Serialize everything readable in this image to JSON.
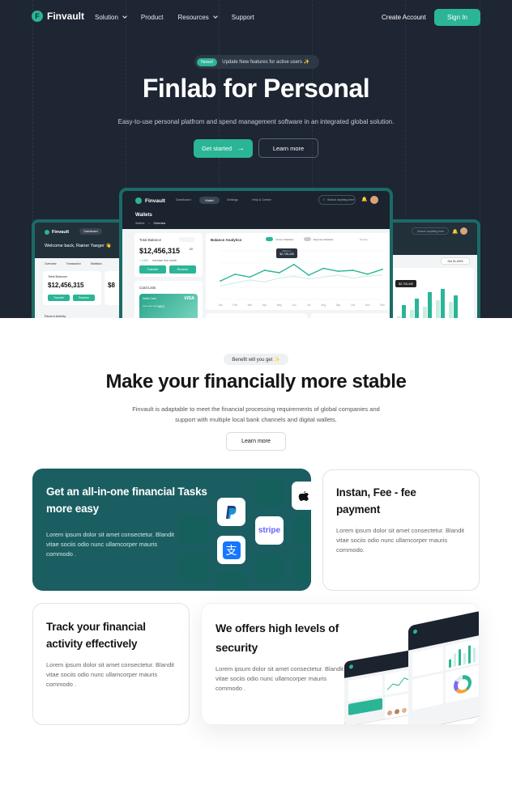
{
  "nav": {
    "brand": "Finvault",
    "brand_mark": "F",
    "links": [
      {
        "label": "Solution",
        "dropdown": true
      },
      {
        "label": "Product",
        "dropdown": false
      },
      {
        "label": "Resources",
        "dropdown": true
      },
      {
        "label": "Support",
        "dropdown": false
      }
    ],
    "create_account": "Create Account",
    "sign_in": "Sign In"
  },
  "hero": {
    "badge": "News!",
    "announcement": "Update New features for active users ✨",
    "title": "Finlab for Personal",
    "subtitle": "Easy-to-use personal platfrom and spend management software in an integrated global solution.",
    "primary_cta": "Get started",
    "secondary_cta": "Learn more"
  },
  "dashboard": {
    "brand": "Finvault",
    "tabs": [
      "Dashboard",
      "Wallet",
      "Settings",
      "Help & Center"
    ],
    "search_placeholder": "Search anything here",
    "page_title": "Wallets",
    "breadcrumb": [
      "Wallets",
      "Overview"
    ],
    "total_balance_label": "Total Balance",
    "total_balance": "$12,456,315",
    "balance_cents": ".00",
    "balance_growth": "+ 4.5%",
    "balance_note": "increase this month",
    "transfer": "Transfer",
    "receive": "Receive",
    "card_lists": "Card Lists",
    "card_network": "VISA",
    "card_label": "Debit Card",
    "card_number": "**** **** **** 8824",
    "analytics_title": "Balance Analytics",
    "toggle_1": "Income Statistics",
    "toggle_2": "Expense Statistics",
    "range": "Monthly",
    "tooltip_label": "Balance",
    "tooltip_value": "$2,745,445",
    "welcome": "Welcome back, Rainer Yaeger 👋",
    "left_tabs": [
      "Overview",
      "Transaction",
      "Statistics"
    ],
    "left_balance": "$12,456,315",
    "recent": "Recent Activity",
    "right_date": "Oct 31,2023",
    "right_tooltip": "$2,745,445",
    "right_value": "$8"
  },
  "chart_data": {
    "type": "line",
    "x": [
      "Jan",
      "Feb",
      "Mar",
      "Apr",
      "May",
      "Jun",
      "Jul",
      "Aug",
      "Sep",
      "Oct",
      "Nov",
      "Dec"
    ],
    "series": [
      {
        "values": [
          38,
          52,
          46,
          60,
          55,
          72,
          50,
          64,
          58,
          60,
          52,
          62
        ],
        "color": "#2bb596"
      },
      {
        "values": [
          28,
          34,
          40,
          36,
          44,
          48,
          42,
          46,
          50,
          44,
          48,
          50
        ],
        "color": "#c9ece2"
      }
    ],
    "ylim": [
      0,
      100
    ]
  },
  "section": {
    "badge": "Benefit will you get ✨",
    "title": "Make your financially more stable",
    "description": "Finvault is adaptable to meet the financial processing requirements of global companies and support with multiple local bank channels and digital wallets.",
    "cta": "Learn more"
  },
  "features": [
    {
      "title": "Get an all-in-one financial Tasks more easy",
      "body": "Lorem ipsum dolor sit amet consectetur. Blandit vitae sociis odio nunc ullamcorper mauris commodo ."
    },
    {
      "title": "Instan, Fee - fee payment",
      "body": "Lorem ipsum dolor sit amet consectetur. Blandit vitae sociis odio nunc ullamcorper mauris commodo."
    },
    {
      "title": "Track your financial activity effectively",
      "body": "Lorem ipsum dolor sit amet consectetur. Blandit vitae sociis odio nunc ullamcorper mauris commodo ."
    },
    {
      "title": "We offers high levels of security",
      "body": "Lorem ipsum dolor sit amet consectetur. Blandit vitae sociis odio nunc ullamcorper mauris commodo ."
    }
  ],
  "integrations": [
    "paypal-icon",
    "stripe-logo",
    "alipay-icon",
    "apple-pay-icon"
  ],
  "stripe_label": "stripe",
  "colors": {
    "accent": "#2bb596",
    "hero_bg": "#1e2533",
    "feature_teal": "#1b5e62",
    "frame": "#1c6a66"
  }
}
